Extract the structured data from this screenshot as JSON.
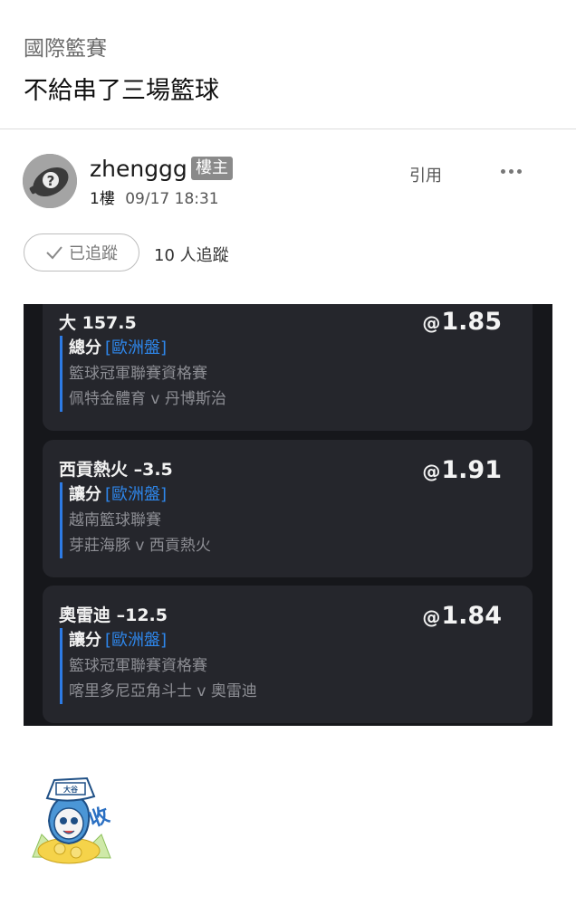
{
  "header": {
    "board": "國際籃賽",
    "title": "不給串了三場籃球"
  },
  "post": {
    "username": "zhenggg",
    "op_badge": "樓主",
    "floor": "1樓",
    "time": "09/17 18:31",
    "quote_label": "引用",
    "follow_label": "已追蹤",
    "follow_count": "10 人追蹤"
  },
  "bet_slip": {
    "accent_color": "#2e87ec",
    "bets": [
      {
        "selection": "大 157.5",
        "odds_prefix": "@",
        "odds": "1.85",
        "market": "總分",
        "market_type": "[歐洲盤]",
        "league": "籃球冠軍聯賽資格賽",
        "match": "佩特金體育 v 丹博斯治"
      },
      {
        "selection": "西貢熱火 –3.5",
        "odds_prefix": "@",
        "odds": "1.91",
        "market": "讓分",
        "market_type": "[歐洲盤]",
        "league": "越南籃球聯賽",
        "match": "芽莊海豚 v 西貢熱火"
      },
      {
        "selection": "奧雷迪 –12.5",
        "odds_prefix": "@",
        "odds": "1.84",
        "market": "讓分",
        "market_type": "[歐洲盤]",
        "league": "籃球冠軍聯賽資格賽",
        "match": "喀里多尼亞角斗士 v 奧雷迪"
      }
    ]
  },
  "sticker": {
    "text": "收",
    "hat_text": "大谷"
  }
}
